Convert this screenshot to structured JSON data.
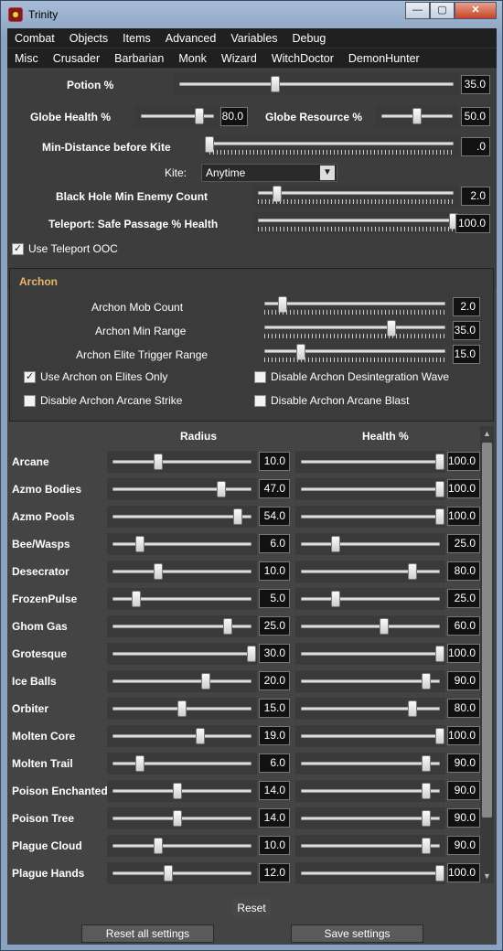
{
  "window": {
    "title": "Trinity",
    "min": "—",
    "max": "▢",
    "close": "✕"
  },
  "tabs_row1": [
    "Combat",
    "Objects",
    "Items",
    "Advanced",
    "Variables",
    "Debug"
  ],
  "tabs_row2": [
    "Misc",
    "Crusader",
    "Barbarian",
    "Monk",
    "Wizard",
    "WitchDoctor",
    "DemonHunter"
  ],
  "top": {
    "potion": {
      "label": "Potion %",
      "value": "35.0",
      "level": 0.35
    },
    "globe_health": {
      "label": "Globe Health %",
      "value": "80.0",
      "level": 0.8
    },
    "globe_resource": {
      "label": "Globe Resource %",
      "value": "50.0",
      "level": 0.5
    },
    "min_distance": {
      "label": "Min-Distance before Kite",
      "value": ".0",
      "level": 0.0
    },
    "kite": {
      "label": "Kite:",
      "selected": "Anytime",
      "dropdown_icon": "chevron-down-icon"
    },
    "black_hole": {
      "label": "Black Hole Min Enemy Count",
      "value": "2.0",
      "level": 0.1
    },
    "teleport": {
      "label": "Teleport: Safe Passage % Health",
      "value": "100.0",
      "level": 1.0
    },
    "use_teleport_ooc": {
      "label": "Use Teleport OOC",
      "checked": true
    }
  },
  "archon": {
    "title": "Archon",
    "mob_count": {
      "label": "Archon Mob Count",
      "value": "2.0",
      "level": 0.1
    },
    "min_range": {
      "label": "Archon Min Range",
      "value": "35.0",
      "level": 0.7
    },
    "elite_range": {
      "label": "Archon Elite Trigger Range",
      "value": "15.0",
      "level": 0.2
    },
    "use_on_elites": {
      "label": "Use Archon on Elites Only",
      "checked": true
    },
    "disable_wave": {
      "label": "Disable Archon Desintegration Wave",
      "checked": false
    },
    "disable_strike": {
      "label": "Disable Archon Arcane Strike",
      "checked": false
    },
    "disable_blast": {
      "label": "Disable Archon Arcane Blast",
      "checked": false
    }
  },
  "avoidance": {
    "header_radius": "Radius",
    "header_health": "Health %",
    "rows": [
      {
        "name": "Arcane",
        "radius": "10.0",
        "r": 0.33,
        "health": "100.0",
        "h": 1.0
      },
      {
        "name": "Azmo Bodies",
        "radius": "47.0",
        "r": 0.78,
        "health": "100.0",
        "h": 1.0
      },
      {
        "name": "Azmo Pools",
        "radius": "54.0",
        "r": 0.9,
        "health": "100.0",
        "h": 1.0
      },
      {
        "name": "Bee/Wasps",
        "radius": "6.0",
        "r": 0.2,
        "health": "25.0",
        "h": 0.25
      },
      {
        "name": "Desecrator",
        "radius": "10.0",
        "r": 0.33,
        "health": "80.0",
        "h": 0.8
      },
      {
        "name": "FrozenPulse",
        "radius": "5.0",
        "r": 0.17,
        "health": "25.0",
        "h": 0.25
      },
      {
        "name": "Ghom Gas",
        "radius": "25.0",
        "r": 0.83,
        "health": "60.0",
        "h": 0.6
      },
      {
        "name": "Grotesque",
        "radius": "30.0",
        "r": 1.0,
        "health": "100.0",
        "h": 1.0
      },
      {
        "name": "Ice Balls",
        "radius": "20.0",
        "r": 0.67,
        "health": "90.0",
        "h": 0.9
      },
      {
        "name": "Orbiter",
        "radius": "15.0",
        "r": 0.5,
        "health": "80.0",
        "h": 0.8
      },
      {
        "name": "Molten Core",
        "radius": "19.0",
        "r": 0.63,
        "health": "100.0",
        "h": 1.0
      },
      {
        "name": "Molten Trail",
        "radius": "6.0",
        "r": 0.2,
        "health": "90.0",
        "h": 0.9
      },
      {
        "name": "Poison Enchanted",
        "radius": "14.0",
        "r": 0.47,
        "health": "90.0",
        "h": 0.9
      },
      {
        "name": "Poison Tree",
        "radius": "14.0",
        "r": 0.47,
        "health": "90.0",
        "h": 0.9
      },
      {
        "name": "Plague Cloud",
        "radius": "10.0",
        "r": 0.33,
        "health": "90.0",
        "h": 0.9
      },
      {
        "name": "Plague Hands",
        "radius": "12.0",
        "r": 0.4,
        "health": "100.0",
        "h": 1.0
      },
      {
        "name": "",
        "radius": "",
        "r": 0.27,
        "health": "",
        "h": 0.85
      }
    ]
  },
  "buttons": {
    "reset": "Reset",
    "reset_all": "Reset all settings",
    "save": "Save settings"
  }
}
